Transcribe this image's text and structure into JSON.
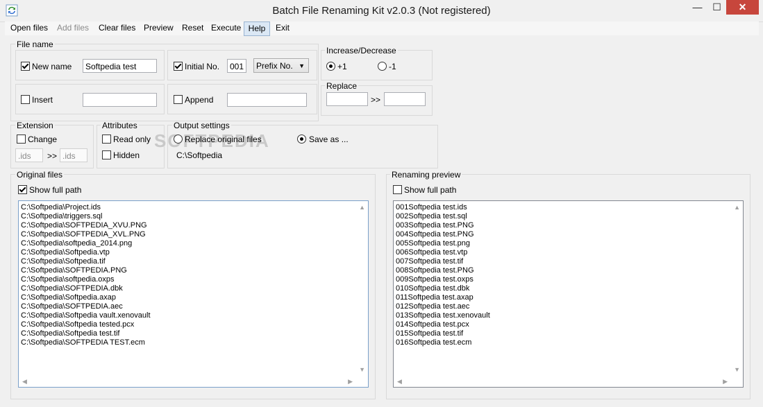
{
  "window": {
    "title": "Batch File Renaming Kit v2.0.3 (Not registered)",
    "minimize": "—",
    "maximize": "☐",
    "close": "✕"
  },
  "menu": {
    "items": [
      "Open files",
      "Add files",
      "Clear files",
      "Preview",
      "Reset",
      "Execute",
      "Help",
      "Exit"
    ],
    "disabled": [
      "Add files"
    ],
    "active": "Help"
  },
  "file_name": {
    "group_label": "File name",
    "new_name": {
      "label": "New name",
      "checked": true,
      "value": "Softpedia test"
    },
    "initial_no": {
      "label": "Initial No.",
      "checked": true,
      "value": "001",
      "mode": "Prefix No."
    },
    "insert": {
      "label": "Insert",
      "checked": false,
      "value": ""
    },
    "append": {
      "label": "Append",
      "checked": false,
      "value": ""
    }
  },
  "increase_decrease": {
    "group_label": "Increase/Decrease",
    "plus": "+1",
    "minus": "-1",
    "selected": "+1"
  },
  "replace": {
    "group_label": "Replace",
    "from": "",
    "separator": ">>",
    "to": ""
  },
  "extension": {
    "group_label": "Extension",
    "change_label": "Change",
    "checked": false,
    "from": ".ids",
    "separator": ">>",
    "to": ".ids"
  },
  "attributes": {
    "group_label": "Attributes",
    "read_only": "Read only",
    "hidden": "Hidden"
  },
  "output": {
    "group_label": "Output settings",
    "replace_original": "Replace original files",
    "save_as": "Save as ...",
    "selected": "Save as ...",
    "path": "C:\\Softpedia"
  },
  "watermark": "SOFTPEDIA",
  "original_files": {
    "group_label": "Original files",
    "show_full_path": "Show full path",
    "checked": true,
    "items": [
      "C:\\Softpedia\\Project.ids",
      "C:\\Softpedia\\triggers.sql",
      "C:\\Softpedia\\SOFTPEDIA_XVU.PNG",
      "C:\\Softpedia\\SOFTPEDIA_XVL.PNG",
      "C:\\Softpedia\\softpedia_2014.png",
      "C:\\Softpedia\\Softpedia.vtp",
      "C:\\Softpedia\\Softpedia.tif",
      "C:\\Softpedia\\SOFTPEDIA.PNG",
      "C:\\Softpedia\\softpedia.oxps",
      "C:\\Softpedia\\SOFTPEDIA.dbk",
      "C:\\Softpedia\\Softpedia.axap",
      "C:\\Softpedia\\SOFTPEDIA.aec",
      "C:\\Softpedia\\Softpedia vault.xenovault",
      "C:\\Softpedia\\Softpedia tested.pcx",
      "C:\\Softpedia\\Softpedia test.tif",
      "C:\\Softpedia\\SOFTPEDIA TEST.ecm"
    ]
  },
  "renaming_preview": {
    "group_label": "Renaming preview",
    "show_full_path": "Show full path",
    "checked": false,
    "items": [
      "001Softpedia test.ids",
      "002Softpedia test.sql",
      "003Softpedia test.PNG",
      "004Softpedia test.PNG",
      "005Softpedia test.png",
      "006Softpedia test.vtp",
      "007Softpedia test.tif",
      "008Softpedia test.PNG",
      "009Softpedia test.oxps",
      "010Softpedia test.dbk",
      "011Softpedia test.axap",
      "012Softpedia test.aec",
      "013Softpedia test.xenovault",
      "014Softpedia test.pcx",
      "015Softpedia test.tif",
      "016Softpedia test.ecm"
    ]
  },
  "scroll": {
    "up": "▲",
    "down": "▼",
    "left": "◀",
    "right": "▶"
  },
  "colors": {
    "close_button": "#c7463c",
    "active_menu": "#dbe8f5",
    "window_bg": "#f0f0f0"
  }
}
